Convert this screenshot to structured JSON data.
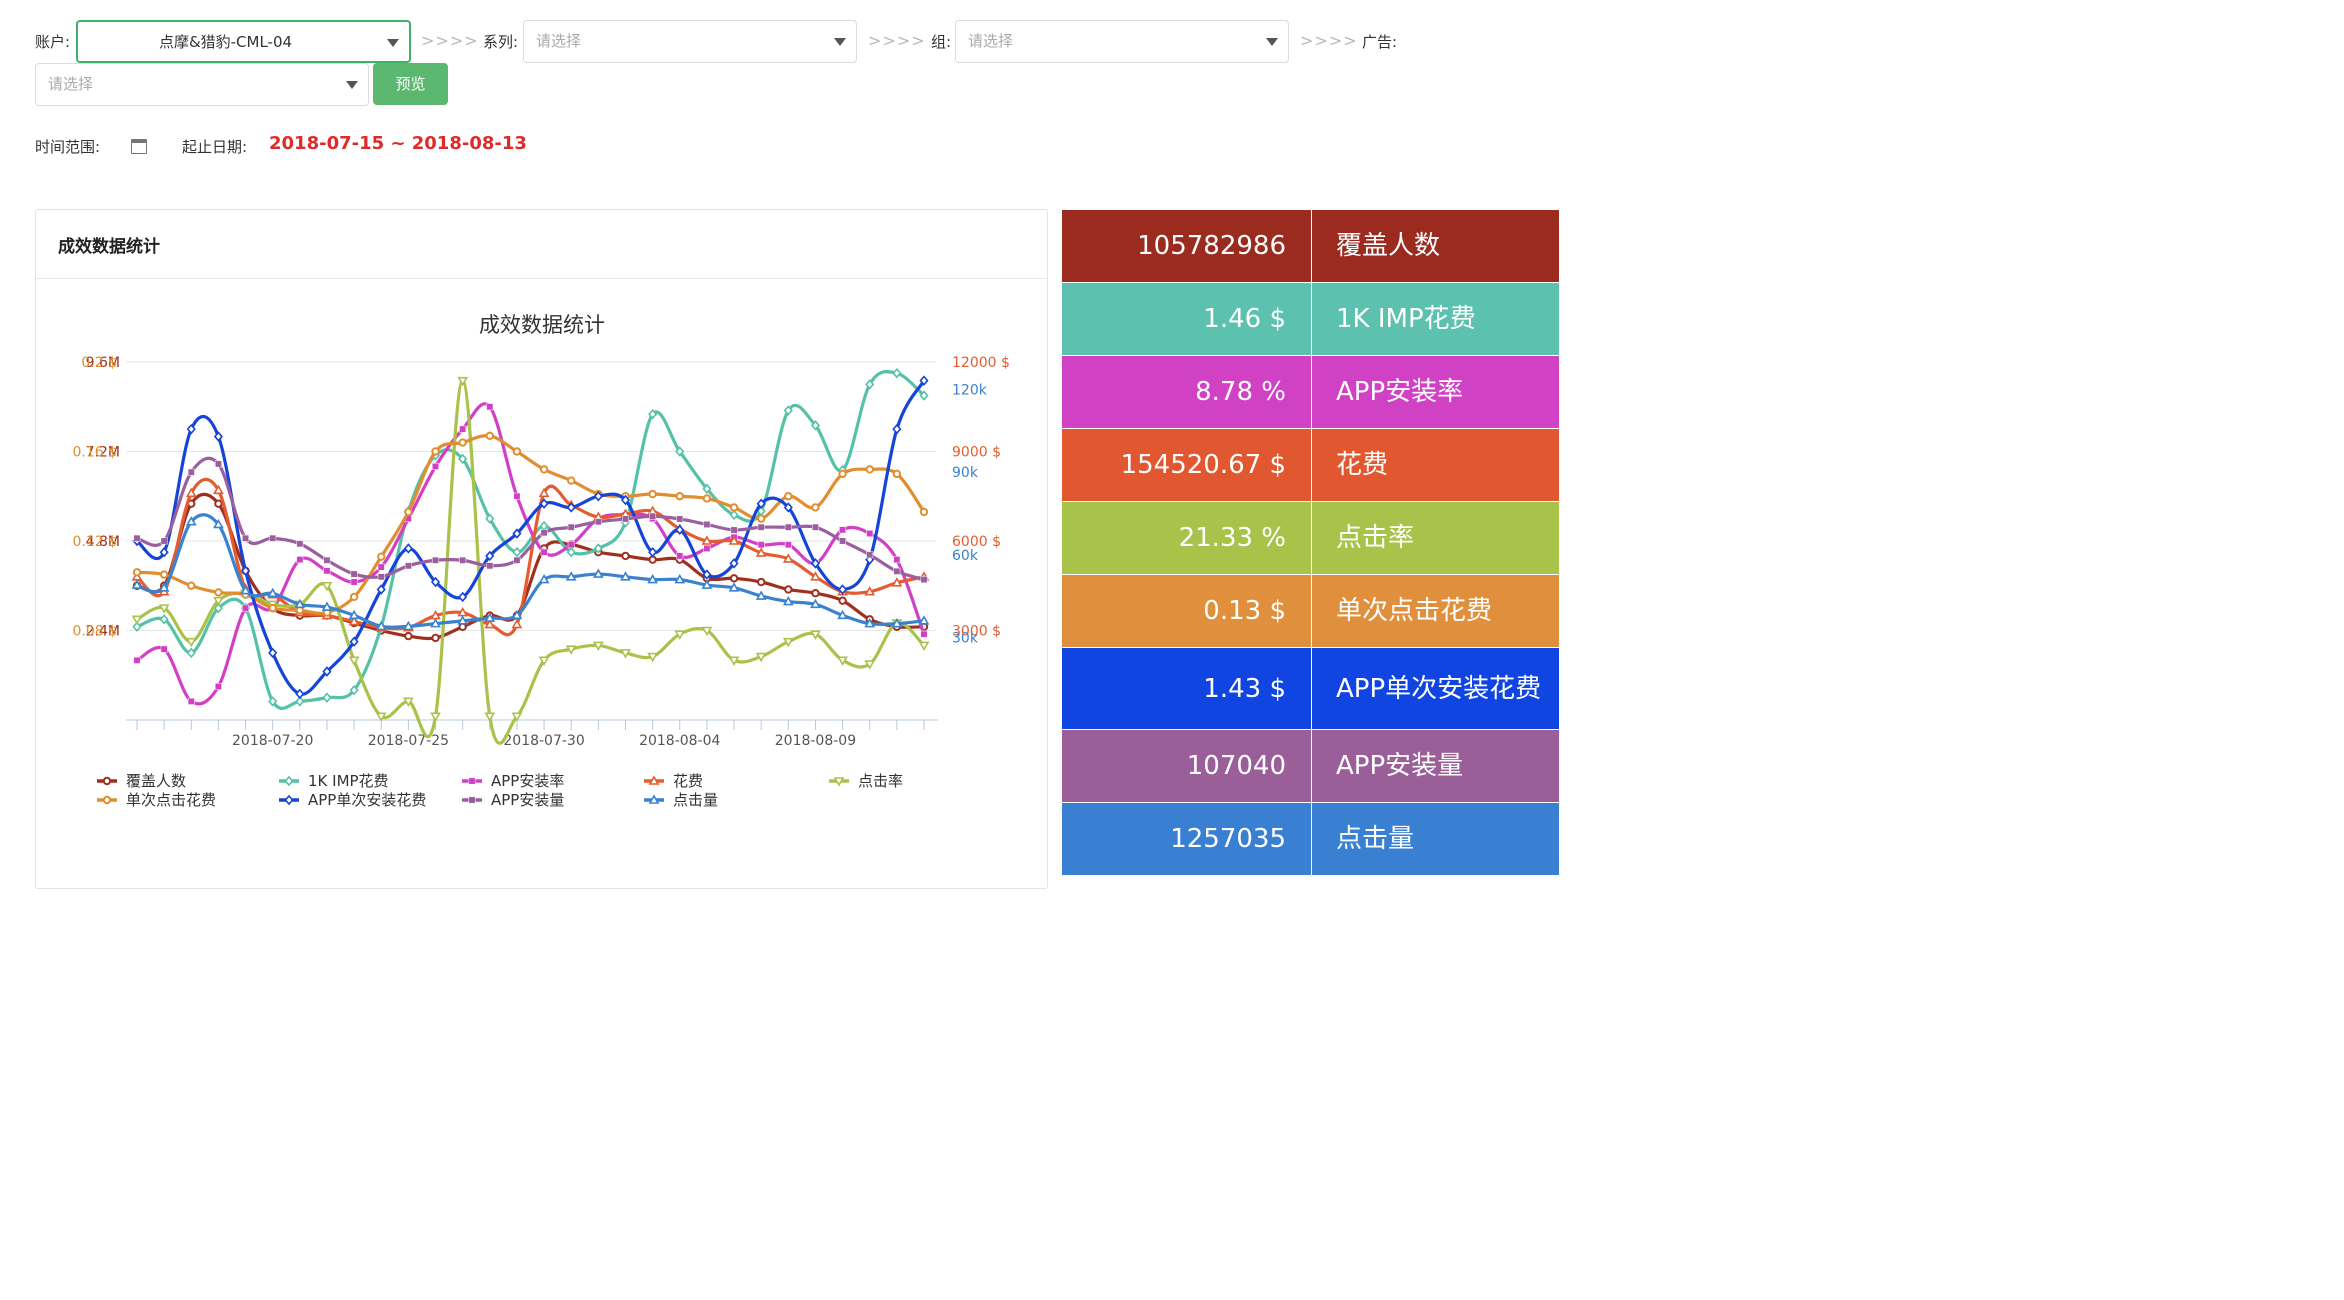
{
  "filters": {
    "account_label": "账户:",
    "account_value": "点摩&猎豹-CML-04",
    "series_label": "系列:",
    "series_placeholder": "请选择",
    "group_label": "组:",
    "group_placeholder": "请选择",
    "ad_label": "广告:",
    "ad_placeholder": "请选择",
    "separator": ">>>>",
    "preview_button": "预览"
  },
  "time": {
    "range_label": "时间范围:",
    "date_label": "起止日期:",
    "date_range": "2018-07-15 ~ 2018-08-13"
  },
  "card": {
    "title": "成效数据统计"
  },
  "chart_data": {
    "type": "line",
    "title": "成效数据统计",
    "smooth": true,
    "dates": [
      "2018-07-15",
      "2018-07-16",
      "2018-07-17",
      "2018-07-18",
      "2018-07-19",
      "2018-07-20",
      "2018-07-21",
      "2018-07-22",
      "2018-07-23",
      "2018-07-24",
      "2018-07-25",
      "2018-07-26",
      "2018-07-27",
      "2018-07-28",
      "2018-07-29",
      "2018-07-30",
      "2018-07-31",
      "2018-08-01",
      "2018-08-02",
      "2018-08-03",
      "2018-08-04",
      "2018-08-05",
      "2018-08-06",
      "2018-08-07",
      "2018-08-08",
      "2018-08-09",
      "2018-08-10",
      "2018-08-11",
      "2018-08-12",
      "2018-08-13"
    ],
    "x_ticks": [
      "2018-07-20",
      "2018-07-25",
      "2018-07-30",
      "2018-08-04",
      "2018-08-09"
    ],
    "axes": {
      "left_outer": {
        "ticks": [
          "2.4M",
          "4.8M",
          "7.2M",
          "9.6M"
        ],
        "values": [
          2400000,
          4800000,
          7200000,
          9600000
        ],
        "max": 9600000,
        "color": "#9e2a1e"
      },
      "left_inner": {
        "ticks": [
          "0.08 $",
          "0.12 $",
          "0.16 $",
          "0.2 $"
        ],
        "values": [
          0.08,
          0.12,
          0.16,
          0.2
        ],
        "min": 0.04,
        "max": 0.2,
        "color": "#e08e30"
      },
      "right_inner": {
        "ticks": [
          "3000 $",
          "6000 $",
          "9000 $",
          "12000 $"
        ],
        "values": [
          3000,
          6000,
          9000,
          12000
        ],
        "max": 12000,
        "color": "#e45c2f"
      },
      "right_outer": {
        "ticks": [
          "30k",
          "60k",
          "90k",
          "120k"
        ],
        "values": [
          30000,
          60000,
          90000,
          120000
        ],
        "max": 130000,
        "color": "#3a82d0"
      }
    },
    "series": [
      {
        "name": "覆盖人数",
        "color": "#a02f1e",
        "marker": "circle",
        "axis": "left_outer",
        "values": [
          3600000,
          3600000,
          5800000,
          5800000,
          4000000,
          3000000,
          2800000,
          2800000,
          2600000,
          2400000,
          2250000,
          2200000,
          2500000,
          2800000,
          2800000,
          4600000,
          4700000,
          4500000,
          4400000,
          4300000,
          4300000,
          3800000,
          3800000,
          3700000,
          3500000,
          3400000,
          3200000,
          2700000,
          2500000,
          2500000
        ]
      },
      {
        "name": "1K IMP花费",
        "color": "#55c2a8",
        "marker": "diamond",
        "axis": "left_outer",
        "values": [
          2500000,
          2700000,
          1800000,
          3000000,
          3000000,
          500000,
          500000,
          600000,
          800000,
          2500000,
          5600000,
          7100000,
          7000000,
          5400000,
          4500000,
          5200000,
          4500000,
          4600000,
          5300000,
          8200000,
          7200000,
          6200000,
          5500000,
          5600000,
          8300000,
          7900000,
          6700000,
          9000000,
          9300000,
          8700000
        ]
      },
      {
        "name": "APP安装率",
        "color": "#d23fc6",
        "marker": "square",
        "axis": "left_outer",
        "values": [
          1600000,
          1900000,
          500000,
          900000,
          3000000,
          3000000,
          4300000,
          4000000,
          3700000,
          4100000,
          5400000,
          6800000,
          7800000,
          8400000,
          6000000,
          4500000,
          4700000,
          5400000,
          5500000,
          5400000,
          4400000,
          4600000,
          4900000,
          4700000,
          4700000,
          4200000,
          5100000,
          5000000,
          4300000,
          2300000
        ]
      },
      {
        "name": "花费",
        "color": "#e45c2f",
        "marker": "triangle",
        "axis": "right_inner",
        "values": [
          4800,
          4300,
          7600,
          7700,
          4400,
          4200,
          3600,
          3500,
          3300,
          3100,
          3100,
          3500,
          3600,
          3200,
          3200,
          7600,
          7200,
          6800,
          6900,
          7000,
          6400,
          6000,
          6000,
          5600,
          5400,
          4800,
          4300,
          4300,
          4600,
          4800
        ]
      },
      {
        "name": "点击率",
        "color": "#a8c24a",
        "marker": "triangle-down",
        "axis": "left_outer",
        "values": [
          2700000,
          3000000,
          2100000,
          3200000,
          3400000,
          3100000,
          3100000,
          3600000,
          1600000,
          100000,
          500000,
          100000,
          9100000,
          100000,
          100000,
          1600000,
          1900000,
          2000000,
          1800000,
          1700000,
          2300000,
          2400000,
          1600000,
          1700000,
          2100000,
          2300000,
          1600000,
          1500000,
          2600000,
          2000000
        ],
        "normalized_note": ""
      },
      {
        "name": "单次点击花费",
        "color": "#e08e30",
        "marker": "circle",
        "axis": "left_inner",
        "values": [
          0.106,
          0.105,
          0.1,
          0.097,
          0.096,
          0.09,
          0.089,
          0.088,
          0.095,
          0.113,
          0.133,
          0.16,
          0.164,
          0.167,
          0.16,
          0.152,
          0.147,
          0.141,
          0.14,
          0.141,
          0.14,
          0.139,
          0.135,
          0.13,
          0.14,
          0.135,
          0.15,
          0.152,
          0.15,
          0.133
        ]
      },
      {
        "name": "APP单次安装花费",
        "color": "#1444d8",
        "marker": "diamond",
        "axis": "left_outer",
        "values": [
          4800000,
          4500000,
          7800000,
          7600000,
          4000000,
          1800000,
          700000,
          1300000,
          2100000,
          3500000,
          4600000,
          3700000,
          3300000,
          4400000,
          5000000,
          5800000,
          5700000,
          6000000,
          5900000,
          4500000,
          5100000,
          3900000,
          4200000,
          5800000,
          5700000,
          4200000,
          3500000,
          4300000,
          7800000,
          9100000
        ]
      },
      {
        "name": "APP安装量",
        "color": "#9b5e9e",
        "marker": "square",
        "axis": "right_outer",
        "values": [
          66000,
          65000,
          90000,
          93000,
          66000,
          66000,
          64000,
          58000,
          53000,
          52000,
          56000,
          58000,
          58000,
          56000,
          58000,
          68000,
          70000,
          72000,
          73000,
          74000,
          73000,
          71000,
          69000,
          70000,
          70000,
          70000,
          65000,
          60000,
          54000,
          51000
        ]
      },
      {
        "name": "点击量",
        "color": "#3a82d0",
        "marker": "triangle",
        "axis": "right_outer",
        "values": [
          49000,
          48000,
          72000,
          71000,
          47000,
          46000,
          42000,
          41000,
          38000,
          34000,
          34000,
          35000,
          36000,
          37000,
          38000,
          51000,
          52000,
          53000,
          52000,
          51000,
          51000,
          49000,
          48000,
          45000,
          43000,
          42000,
          38000,
          35000,
          35000,
          36000
        ]
      }
    ],
    "legend_position": "bottom"
  },
  "stats": [
    {
      "value": "105782986",
      "name": "覆盖人数",
      "color": "#9b2a1f"
    },
    {
      "value": "1.46 $",
      "name": "1K IMP花费",
      "color": "#5cc1ae"
    },
    {
      "value": "8.78 %",
      "name": "APP安装率",
      "color": "#d041c4"
    },
    {
      "value": "154520.67 $",
      "name": "花费",
      "color": "#e1572f"
    },
    {
      "value": "21.33 %",
      "name": "点击率",
      "color": "#a8c34a"
    },
    {
      "value": "0.13 $",
      "name": "单次点击花费",
      "color": "#e0903c"
    },
    {
      "value": "1.43 $",
      "name": "APP单次安装花费",
      "color": "#1045e2"
    },
    {
      "value": "107040",
      "name": "APP安装量",
      "color": "#9a5f98"
    },
    {
      "value": "1257035",
      "name": "点击量",
      "color": "#3a80d2"
    }
  ]
}
